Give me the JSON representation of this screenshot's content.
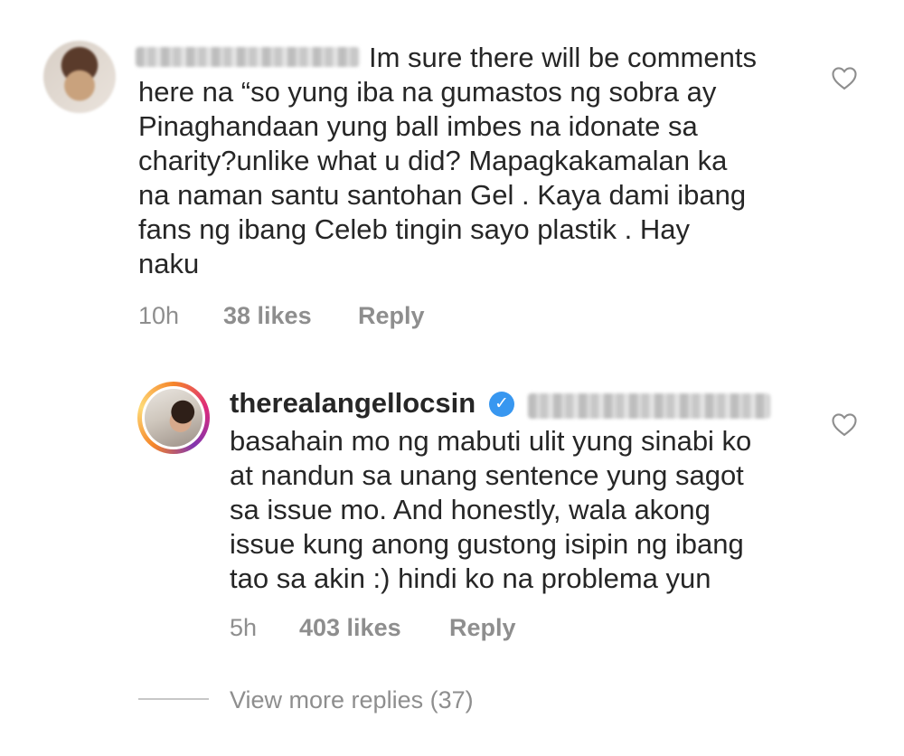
{
  "comments": [
    {
      "username": "",
      "text": "Im sure there will be comments\nhere na “so yung iba na gumastos ng sobra ay\nPinaghandaan yung ball imbes na idonate sa\ncharity?unlike what u did? Mapagkakamalan ka\nna naman santu santohan Gel . Kaya dami ibang\nfans ng ibang Celeb tingin sayo plastik . Hay\nnaku",
      "time": "10h",
      "likes": "38 likes",
      "reply_label": "Reply",
      "icon": "heart-outline-icon"
    },
    {
      "username": "therealangellocsin",
      "verified_icon": "verified-badge-icon",
      "verified_color": "#3897f0",
      "text": "basahain mo ng mabuti ulit yung sinabi ko\nat nandun sa unang sentence yung sagot\nsa issue mo. And honestly, wala akong\nissue kung anong gustong isipin ng ibang\ntao sa akin :) hindi ko na problema yun",
      "time": "5h",
      "likes": "403 likes",
      "reply_label": "Reply",
      "icon": "heart-outline-icon"
    }
  ],
  "view_more": "View more replies (37)",
  "colors": {
    "text": "#262626",
    "muted": "#8e8e8e",
    "verified": "#3897f0"
  }
}
